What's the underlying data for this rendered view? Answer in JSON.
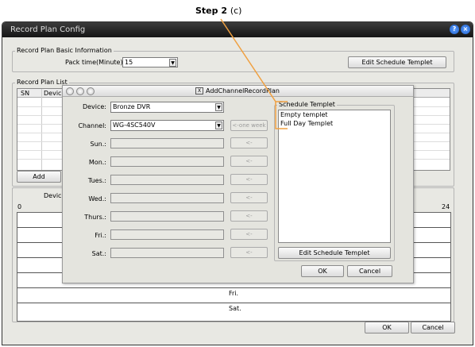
{
  "annotation": {
    "step": "Step 2",
    "sub": "(c)"
  },
  "main_window": {
    "title": "Record Plan Config"
  },
  "basic_info": {
    "title": "Record Plan Basic Information",
    "pack_time_label": "Pack time(Minute):",
    "pack_time_value": "15",
    "edit_schedule_button": "Edit Schedule Templet"
  },
  "plan_list": {
    "title": "Record Plan List",
    "columns": [
      "SN",
      "Device"
    ],
    "add_button": "Add"
  },
  "timeline": {
    "device_label": "Device",
    "scale_start": "0",
    "scale_end": "24",
    "days": [
      "Fri.",
      "Sat."
    ]
  },
  "main_buttons": {
    "ok": "OK",
    "cancel": "Cancel"
  },
  "dialog": {
    "title": "AddChannelRecordPlan",
    "device_label": "Device:",
    "device_value": "Bronze DVR",
    "channel_label": "Channel:",
    "channel_value": "WG-4SC540V",
    "one_week_button": "<-one week",
    "days": [
      {
        "label": "Sun.:",
        "btn": "<-"
      },
      {
        "label": "Mon.:",
        "btn": "<-"
      },
      {
        "label": "Tues.:",
        "btn": "<-"
      },
      {
        "label": "Wed.:",
        "btn": "<-"
      },
      {
        "label": "Thurs.:",
        "btn": "<-"
      },
      {
        "label": "Fri.:",
        "btn": "<-"
      },
      {
        "label": "Sat.:",
        "btn": "<-"
      }
    ],
    "templet_group_title": "Schedule Templet",
    "templets": [
      "Empty templet",
      "Full Day Templet"
    ],
    "edit_templet_button": "Edit Schedule Templet",
    "ok": "OK",
    "cancel": "Cancel"
  },
  "colors": {
    "callout": "#f0a040",
    "titlebar": "#1e1e1e"
  }
}
